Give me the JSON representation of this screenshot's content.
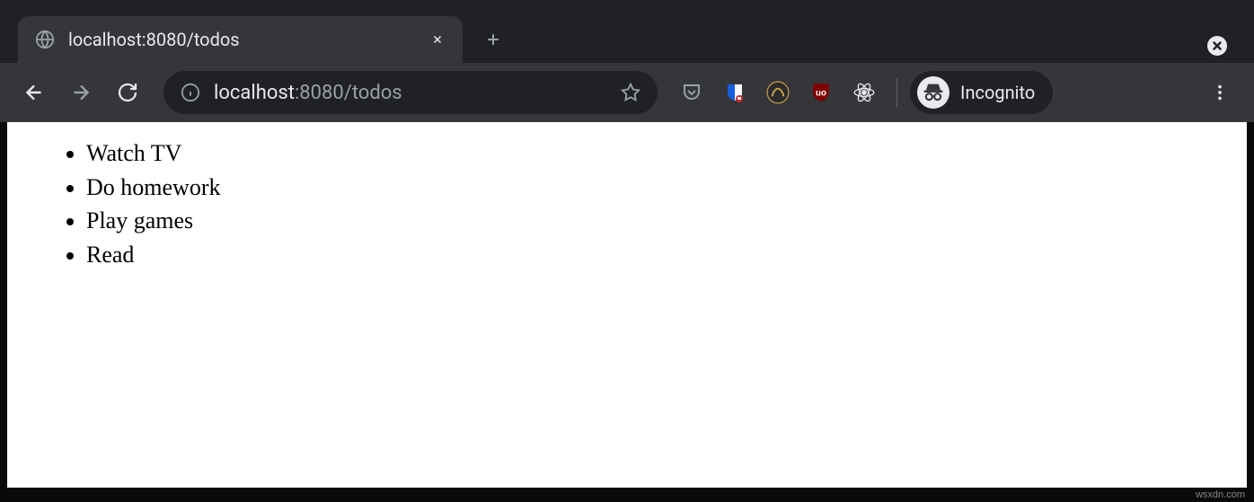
{
  "tab": {
    "title": "localhost:8080/todos"
  },
  "omnibox": {
    "host": "localhost",
    "path": ":8080/todos"
  },
  "incognito": {
    "label": "Incognito"
  },
  "page": {
    "todos": [
      "Watch TV",
      "Do homework",
      "Play games",
      "Read"
    ]
  },
  "watermark": "wsxdn.com"
}
